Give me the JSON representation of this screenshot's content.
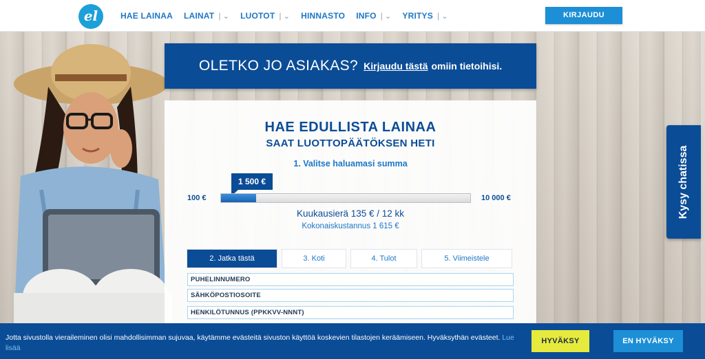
{
  "header": {
    "logo_text": "el",
    "nav": [
      {
        "label": "HAE LAINAA",
        "dropdown": false
      },
      {
        "label": "LAINAT",
        "dropdown": true
      },
      {
        "label": "LUOTOT",
        "dropdown": true
      },
      {
        "label": "HINNASTO",
        "dropdown": false
      },
      {
        "label": "INFO",
        "dropdown": true
      },
      {
        "label": "YRITYS",
        "dropdown": true
      }
    ],
    "login_label": "KIRJAUDU"
  },
  "banner": {
    "question": "OLETKO JO ASIAKAS?",
    "link": "Kirjaudu tästä",
    "rest": "omiin tietoihisi."
  },
  "form": {
    "title": "HAE EDULLISTA LAINAA",
    "subtitle": "SAAT LUOTTOPÄÄTÖKSEN HETI",
    "step1": "1. Valitse haluamasi summa",
    "amount": "1 500 €",
    "min": "100 €",
    "max": "10 000 €",
    "slider_fraction": 0.141,
    "monthly": "Kuukausierä 135 € / 12 kk",
    "total": "Kokonaiskustannus 1 615 €",
    "tabs": [
      {
        "label": "2. Jatka tästä",
        "active": true
      },
      {
        "label": "3. Koti",
        "active": false
      },
      {
        "label": "4. Tulot",
        "active": false
      },
      {
        "label": "5. Viimeistele",
        "active": false
      }
    ],
    "fields": [
      "PUHELINNUMERO",
      "SÄHKÖPOSTIOSOITE",
      "HENKILÖTUNNUS (PPKKVV-NNNT)"
    ]
  },
  "chat": {
    "label": "Kysy chatissa"
  },
  "cookie": {
    "text": "Jotta sivustolla vieraileminen olisi mahdollisimman sujuvaa, käytämme evästeitä sivuston käyttöä koskevien tilastojen keräämiseen. Hyväksythän evästeet.",
    "more_link": "Lue lisää",
    "accept": "HYVÄKSY",
    "decline": "EN HYVÄKSY"
  },
  "colors": {
    "brand": "#0b4c96",
    "accent": "#1d8fd6",
    "accept": "#e6ea3c"
  }
}
